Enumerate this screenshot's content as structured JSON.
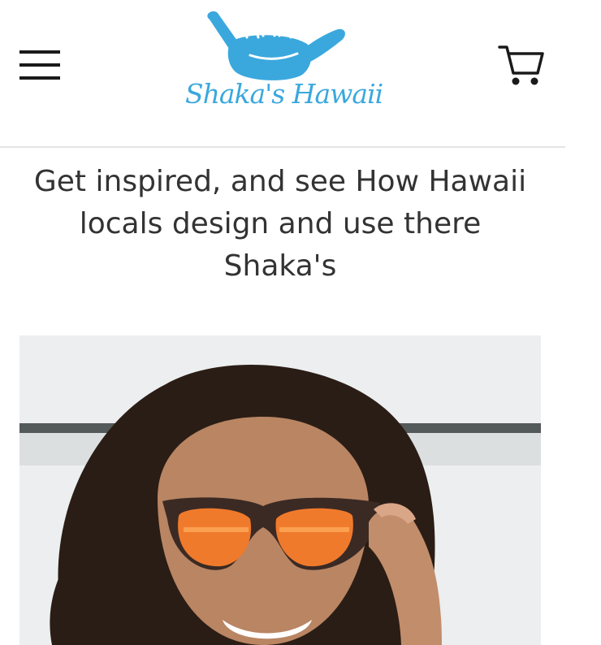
{
  "header": {
    "logo_text": "Shaka's Hawaii",
    "menu_icon": "hamburger-menu-icon",
    "cart_icon": "shopping-cart-icon"
  },
  "main": {
    "headline": "Get inspired, and see How Hawaii locals design and use there Shaka's"
  },
  "colors": {
    "brand": "#3aa8dd",
    "text": "#333333",
    "divider": "#e4e4e4"
  }
}
